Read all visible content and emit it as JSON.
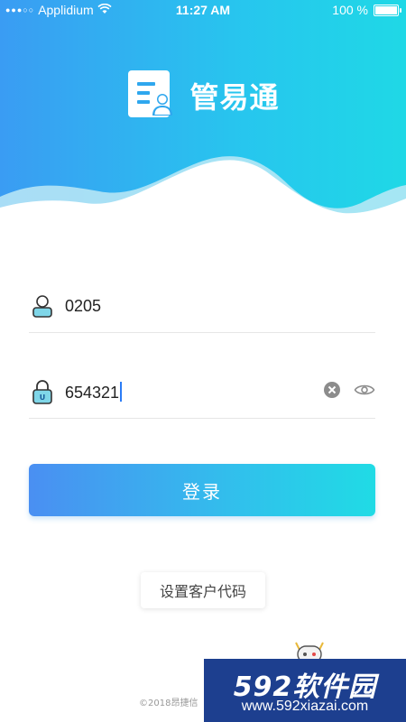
{
  "status_bar": {
    "carrier": "Applidium",
    "time": "11:27 AM",
    "battery": "100 %",
    "battery_level": 1.0
  },
  "app": {
    "name": "管易通",
    "brand_colors": {
      "gradient_start": "#3a9cf3",
      "gradient_end": "#1fd8e6"
    }
  },
  "login_form": {
    "username": {
      "value": "0205",
      "icon": "user-icon"
    },
    "password": {
      "value": "654321",
      "icon": "lock-icon",
      "clear_icon": "clear-icon",
      "reveal_icon": "eye-icon"
    },
    "submit_label": "登录"
  },
  "set_client_code_label": "设置客户代码",
  "footer": {
    "copyright": "©2018昂捷信"
  },
  "watermark": {
    "title": "592软件园",
    "url": "www.592xiazai.com"
  }
}
